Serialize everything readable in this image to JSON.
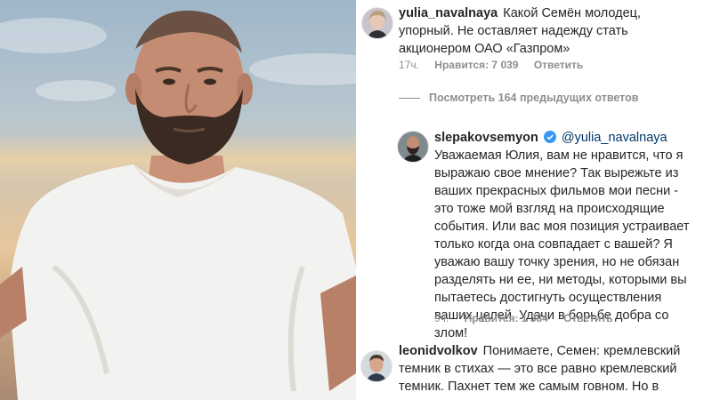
{
  "comments": [
    {
      "username": "yulia_navalnaya",
      "text": "Какой Семён молодец, упорный. Не оставляет надежду стать акционером  ОАО «Газпром»",
      "time": "17ч.",
      "likes": "Нравится: 7 039",
      "reply": "Ответить"
    },
    {
      "replies_link": "Посмотреть 164 предыдущих ответов"
    },
    {
      "username": "slepakovsemyon",
      "mention": "@yulia_navalnaya",
      "text": "Уважаемая Юлия, вам не нравится, что я выражаю свое мнение? Так вырежьте из ваших прекрасных фильмов мои песни - это тоже мой взгляд на происходящие события. Или вас моя позиция устраивает только когда она совпадает с вашей? Я уважаю вашу точку зрения, но не обязан разделять ни ее, ни методы, которыми вы пытаетесь достигнуть осуществления ваших целей. Удачи в борьбе добра со злом!",
      "time": "9ч.",
      "likes": "Нравится: 1 384",
      "reply": "Ответить"
    },
    {
      "username": "leonidvolkov",
      "text": "Понимаете, Семен: кремлевский темник в стихах — это все равно кремлевский темник. Пахнет тем же самым говном. Но в стихах."
    }
  ],
  "icons": {
    "verified": "verified-badge-icon",
    "verified_color": "#3897f0"
  }
}
